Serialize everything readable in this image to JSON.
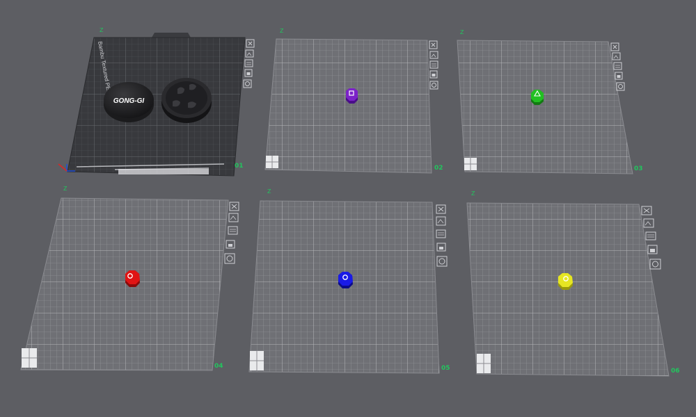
{
  "scene": {
    "background": "#5d5e63",
    "plate_number_color": "#22c55e",
    "axis_label": "Z"
  },
  "plates": [
    {
      "number": "01",
      "type": "textured-pei",
      "plate_label": "Bambu Textured PEI Plate",
      "objects": [
        {
          "name": "cap-top",
          "text": "GONG-GI",
          "color": "#2a2a2c"
        },
        {
          "name": "cap-bottom",
          "text": "",
          "color": "#2a2a2c"
        }
      ]
    },
    {
      "number": "02",
      "type": "empty-grid",
      "objects": [
        {
          "name": "piece",
          "color": "#7c22c8",
          "symbol": "square"
        }
      ]
    },
    {
      "number": "03",
      "type": "empty-grid",
      "objects": [
        {
          "name": "piece",
          "color": "#22c022",
          "symbol": "triangle"
        }
      ]
    },
    {
      "number": "04",
      "type": "empty-grid",
      "objects": [
        {
          "name": "piece",
          "color": "#e01414",
          "symbol": "circle"
        }
      ]
    },
    {
      "number": "05",
      "type": "empty-grid",
      "objects": [
        {
          "name": "piece",
          "color": "#1a1ae6",
          "symbol": "circle"
        }
      ]
    },
    {
      "number": "06",
      "type": "empty-grid",
      "objects": [
        {
          "name": "piece",
          "color": "#e6e622",
          "symbol": "circle"
        }
      ]
    }
  ],
  "plate_toolbar": {
    "icons": [
      "close-icon",
      "arrange-icon",
      "orient-icon",
      "lock-icon",
      "settings-icon"
    ]
  }
}
